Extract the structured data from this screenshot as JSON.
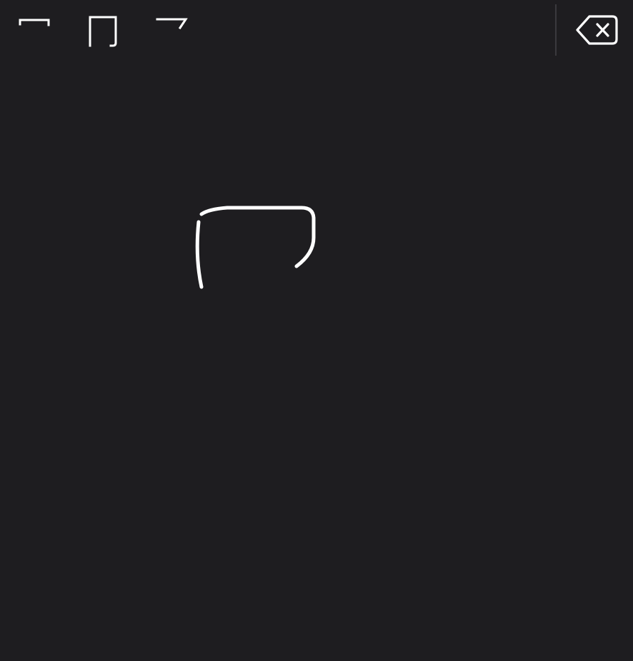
{
  "keyboard": {
    "mode": "handwriting",
    "candidates": [
      {
        "char": "冖",
        "icon": "character-mi-icon"
      },
      {
        "char": "冂",
        "icon": "character-jiong-icon"
      },
      {
        "char": "乛",
        "icon": "character-hook-icon"
      }
    ],
    "delete_icon": "delete-backward-icon"
  },
  "colors": {
    "background": "#1e1d20",
    "ink": "#ffffff",
    "divider": "#3a393d"
  }
}
